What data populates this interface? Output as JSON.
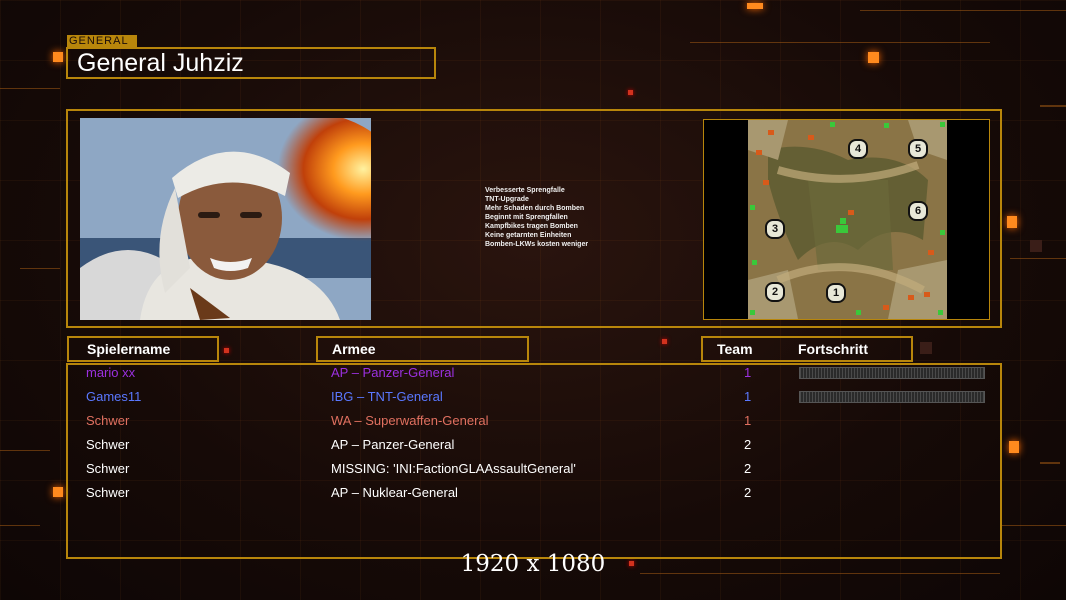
{
  "screen": {
    "tag": "GENERAL",
    "title": "General Juhziz",
    "resolution": "1920 x 1080"
  },
  "features": [
    "Verbesserte Sprengfalle",
    "TNT-Upgrade",
    "Mehr Schaden durch Bomben",
    "Beginnt mit Sprengfallen",
    "Kampfbikes tragen Bomben",
    "Keine getarnten Einheiten",
    "Bomben-LKWs kosten weniger"
  ],
  "minimap": {
    "start_positions": [
      "4",
      "5",
      "6",
      "3",
      "2",
      "1"
    ]
  },
  "table": {
    "headers": {
      "player": "Spielername",
      "army": "Armee",
      "team": "Team",
      "progress": "Fortschritt"
    },
    "rows": [
      {
        "player": "mario xx",
        "army": "AP – Panzer-General",
        "team": "1",
        "color": "#9b30e0",
        "progress": true
      },
      {
        "player": "Games11",
        "army": "IBG – TNT-General",
        "team": "1",
        "color": "#5a78ff",
        "progress": true
      },
      {
        "player": "Schwer",
        "army": "WA – Superwaffen-General",
        "team": "1",
        "color": "#e07060",
        "progress": false
      },
      {
        "player": "Schwer",
        "army": "AP – Panzer-General",
        "team": "2",
        "color": "#ffffff",
        "progress": false
      },
      {
        "player": "Schwer",
        "army": "MISSING: 'INI:FactionGLAAssaultGeneral'",
        "team": "2",
        "color": "#ffffff",
        "progress": false
      },
      {
        "player": "Schwer",
        "army": "AP – Nuklear-General",
        "team": "2",
        "color": "#ffffff",
        "progress": false
      }
    ]
  },
  "colors": {
    "frame": "#b8860b",
    "accent": "#ff8a1e"
  }
}
